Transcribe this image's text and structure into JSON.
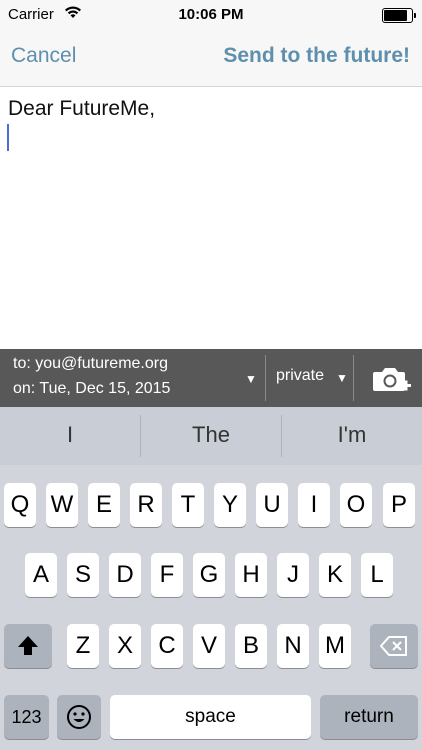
{
  "status": {
    "carrier": "Carrier",
    "time": "10:06 PM"
  },
  "nav": {
    "cancel": "Cancel",
    "send": "Send to the future!"
  },
  "editor": {
    "text": "Dear FutureMe,"
  },
  "toolbar": {
    "to": "to: you@futureme.org",
    "on": "on: Tue, Dec 15, 2015",
    "privacy": "private",
    "dropdown_glyph": "▼"
  },
  "keyboard": {
    "suggestions": [
      "I",
      "The",
      "I'm"
    ],
    "row1": [
      "Q",
      "W",
      "E",
      "R",
      "T",
      "Y",
      "U",
      "I",
      "O",
      "P"
    ],
    "row2": [
      "A",
      "S",
      "D",
      "F",
      "G",
      "H",
      "J",
      "K",
      "L"
    ],
    "row3": [
      "Z",
      "X",
      "C",
      "V",
      "B",
      "N",
      "M"
    ],
    "numbers_label": "123",
    "space_label": "space",
    "return_label": "return",
    "icons": {
      "shift": "shift-icon",
      "delete": "delete-icon",
      "emoji": "emoji-icon"
    }
  }
}
